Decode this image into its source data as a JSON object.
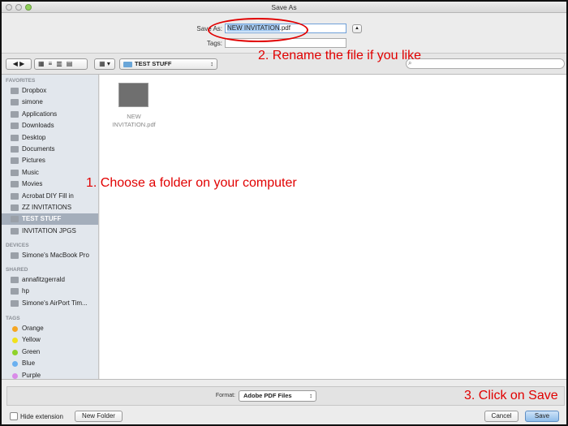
{
  "window": {
    "title": "Save As"
  },
  "header": {
    "save_as_label": "Save As:",
    "filename_selected": "NEW INVITATION",
    "filename_ext": ".pdf",
    "tags_label": "Tags:",
    "tags_value": ""
  },
  "toolbar": {
    "location": "TEST STUFF",
    "search_placeholder": ""
  },
  "sidebar": {
    "favorites_label": "FAVORITES",
    "favorites": [
      "Dropbox",
      "simone",
      "Applications",
      "Downloads",
      "Desktop",
      "Documents",
      "Pictures",
      "Music",
      "Movies",
      "Acrobat DIY Fill in",
      "ZZ INVITATIONS",
      "TEST STUFF",
      "INVITATION JPGS"
    ],
    "selected": "TEST STUFF",
    "devices_label": "DEVICES",
    "devices": [
      "Simone's MacBook Pro"
    ],
    "shared_label": "SHARED",
    "shared": [
      "annafitzgerrald",
      "hp",
      "Simone's AirPort Tim..."
    ],
    "tags_label": "TAGS",
    "tags": [
      {
        "label": "Orange",
        "color": "#f5a623"
      },
      {
        "label": "Yellow",
        "color": "#f1e11b"
      },
      {
        "label": "Green",
        "color": "#8fd22b"
      },
      {
        "label": "Blue",
        "color": "#6ab0f0"
      },
      {
        "label": "Purple",
        "color": "#d98be8"
      }
    ]
  },
  "main": {
    "file": {
      "name_line1": "NEW",
      "name_line2": "INVITATION.pdf"
    }
  },
  "annotations": {
    "note1": "1. Choose a folder on your computer",
    "note2": "2. Rename the file if you like",
    "note3": "3. Click on Save",
    "accent": "#e10000"
  },
  "bottom": {
    "format_label": "Format:",
    "format_value": "Adobe PDF Files",
    "hide_extension": "Hide extension",
    "hide_extension_checked": false,
    "new_folder": "New Folder",
    "cancel": "Cancel",
    "save": "Save"
  }
}
